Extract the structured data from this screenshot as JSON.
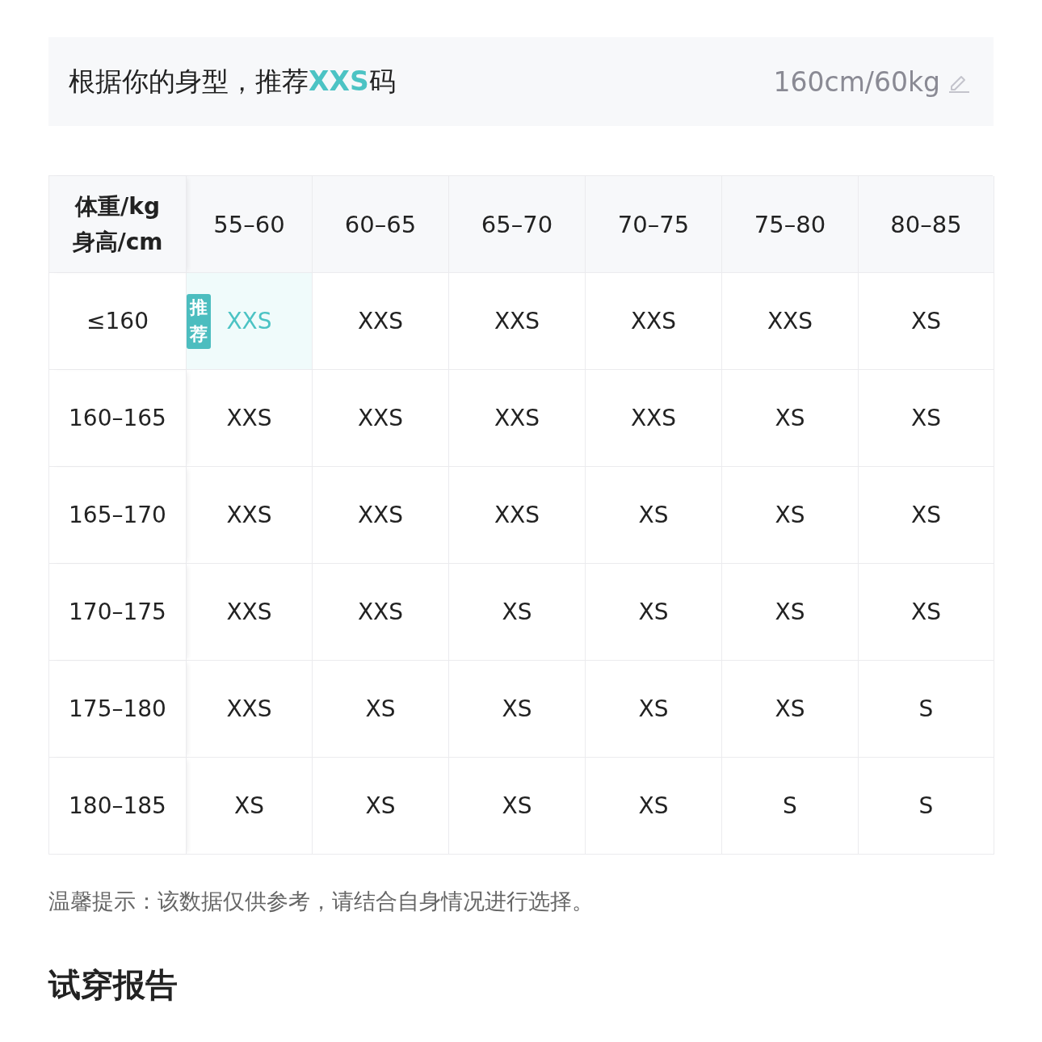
{
  "recommendation": {
    "text": "根据你的身型，推荐**XXS**码",
    "body_measurements": "160cm/60kg"
  },
  "size_table": {
    "corner": {
      "top": "体重/kg",
      "bottom": "身高/cm"
    },
    "columns": [
      "55–60",
      "60–65",
      "65–70",
      "70–75",
      "75–80",
      "80–85"
    ],
    "rows": [
      {
        "height": "≤160",
        "cells": [
          {
            "size": "XXS",
            "selected": true,
            "badge": "推荐"
          },
          {
            "size": "XXS",
            "selected": false
          },
          {
            "size": "XXS",
            "selected": false
          },
          {
            "size": "XXS",
            "selected": false
          },
          {
            "size": "XXS",
            "selected": false
          },
          {
            "size": "XS",
            "selected": false
          }
        ]
      },
      {
        "height": "160–165",
        "cells": [
          {
            "size": "XXS",
            "selected": false
          },
          {
            "size": "XXS",
            "selected": false
          },
          {
            "size": "XXS",
            "selected": false
          },
          {
            "size": "XXS",
            "selected": false
          },
          {
            "size": "XS",
            "selected": false
          },
          {
            "size": "XS",
            "selected": false
          }
        ]
      },
      {
        "height": "165–170",
        "cells": [
          {
            "size": "XXS",
            "selected": false
          },
          {
            "size": "XXS",
            "selected": false
          },
          {
            "size": "XXS",
            "selected": false
          },
          {
            "size": "XS",
            "selected": false
          },
          {
            "size": "XS",
            "selected": false
          },
          {
            "size": "XS",
            "selected": false
          }
        ]
      },
      {
        "height": "170–175",
        "cells": [
          {
            "size": "XXS",
            "selected": false
          },
          {
            "size": "XXS",
            "selected": false
          },
          {
            "size": "XS",
            "selected": false
          },
          {
            "size": "XS",
            "selected": false
          },
          {
            "size": "XS",
            "selected": false
          },
          {
            "size": "XS",
            "selected": false
          }
        ]
      },
      {
        "height": "175–180",
        "cells": [
          {
            "size": "XXS",
            "selected": false
          },
          {
            "size": "XS",
            "selected": false
          },
          {
            "size": "XS",
            "selected": false
          },
          {
            "size": "XS",
            "selected": false
          },
          {
            "size": "XS",
            "selected": false
          },
          {
            "size": "S",
            "selected": false
          }
        ]
      },
      {
        "height": "180–185",
        "cells": [
          {
            "size": "XS",
            "selected": false
          },
          {
            "size": "XS",
            "selected": false
          },
          {
            "size": "XS",
            "selected": false
          },
          {
            "size": "XS",
            "selected": false
          },
          {
            "size": "S",
            "selected": false
          },
          {
            "size": "S",
            "selected": false
          }
        ]
      }
    ]
  },
  "tip": "温馨提示：该数据仅供参考，请结合自身情况进行选择。",
  "section_title": "试穿报告"
}
